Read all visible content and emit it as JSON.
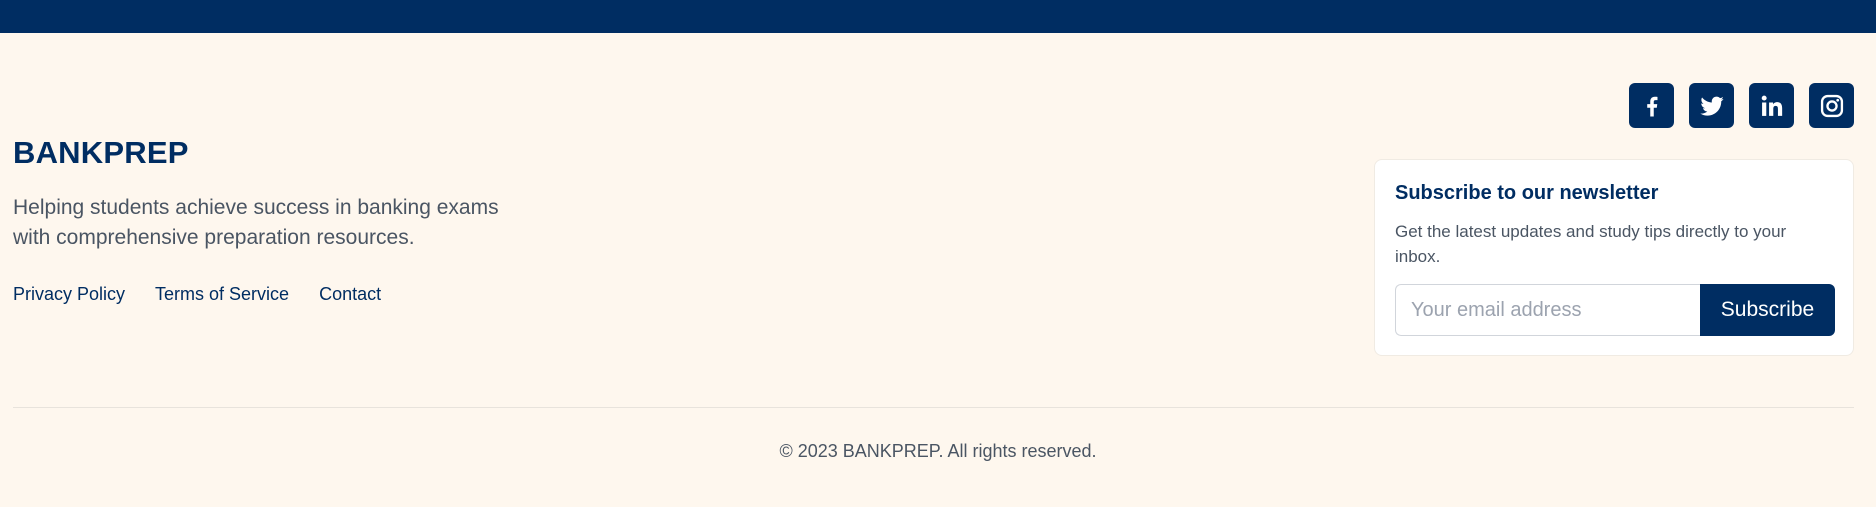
{
  "brand": {
    "name": "BANKPREP",
    "tagline": "Helping students achieve success in banking exams with comprehensive preparation resources."
  },
  "footer_links": [
    {
      "label": "Privacy Policy"
    },
    {
      "label": "Terms of Service"
    },
    {
      "label": "Contact"
    }
  ],
  "socials": [
    {
      "icon": "facebook-icon"
    },
    {
      "icon": "twitter-icon"
    },
    {
      "icon": "linkedin-icon"
    },
    {
      "icon": "instagram-icon"
    }
  ],
  "newsletter": {
    "title": "Subscribe to our newsletter",
    "description": "Get the latest updates and study tips directly to your inbox.",
    "email_placeholder": "Your email address",
    "email_value": "",
    "button_label": "Subscribe"
  },
  "copyright": "© 2023 BANKPREP. All rights reserved.",
  "colors": {
    "primary": "#002d62",
    "background": "#fef7ee",
    "text_muted": "#4a5563"
  }
}
